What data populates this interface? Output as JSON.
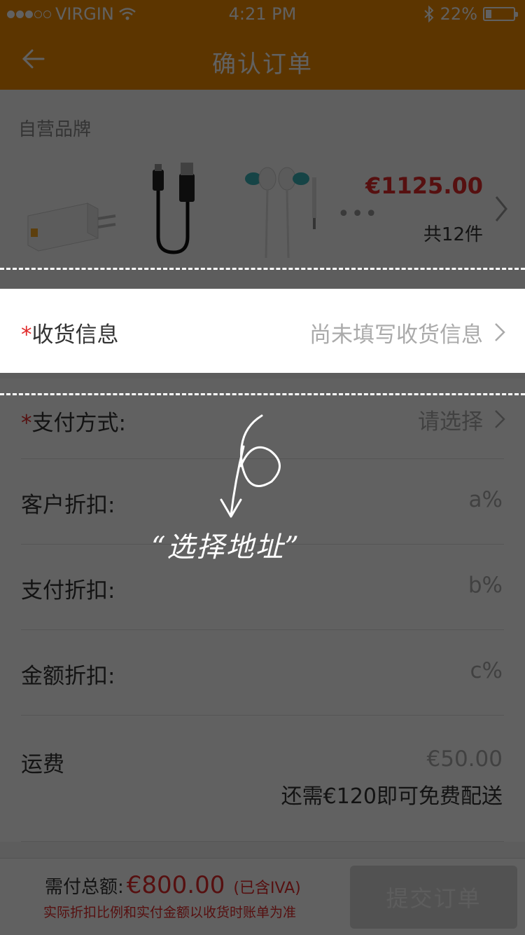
{
  "status_bar": {
    "carrier": "VIRGIN",
    "time": "4:21 PM",
    "battery": "22%",
    "battery_level": 0.22,
    "signal_filled": 3,
    "signal_total": 5
  },
  "nav": {
    "title": "确认订单",
    "back_icon": "back-arrow-icon"
  },
  "products": {
    "brand": "自营品牌",
    "items": [
      "charger-icon",
      "usb-cable-icon",
      "earphones-icon"
    ],
    "more": "•••",
    "price": "€1125.00",
    "count": "共12件"
  },
  "form": {
    "shipping_info": {
      "required_mark": "*",
      "label": "收货信息",
      "value": "尚未填写收货信息"
    },
    "payment_method": {
      "required_mark": "*",
      "label": "支付方式:",
      "value": "请选择"
    },
    "customer_discount": {
      "label": "客户折扣:",
      "value": "a%"
    },
    "payment_discount": {
      "label": "支付折扣:",
      "value": "b%"
    },
    "amount_discount": {
      "label": "金额折扣:",
      "value": "c%"
    },
    "shipping_fee": {
      "label": "运费",
      "value": "€50.00",
      "hint": "还需€120即可免费配送"
    }
  },
  "footer": {
    "total_label": "需付总额:",
    "total_amount": "€800.00",
    "total_tax": "(已含IVA)",
    "note": "实际折扣比例和实付金额以收货时账单为准",
    "submit_label": "提交订单"
  },
  "annotation": {
    "step_number": "6",
    "text": "“选择地址”"
  },
  "colors": {
    "brand_orange": "#f28c00",
    "price_red": "#e12a2a",
    "overlay": "rgba(0,0,0,0.62)"
  }
}
